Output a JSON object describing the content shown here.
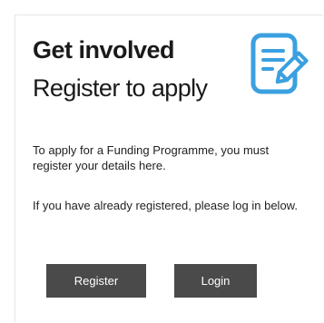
{
  "card": {
    "title": "Get involved",
    "subtitle": "Register to apply",
    "icon": "form-edit-icon",
    "paragraphs": [
      "To apply for a Funding Programme, you must register your details here.",
      "If you have already registered, please log in below."
    ],
    "buttons": {
      "register_label": "Register",
      "login_label": "Login"
    }
  },
  "colors": {
    "icon_blue": "#3aa0e0",
    "button_bg": "#4a4a4a",
    "text": "#1a1a1a"
  }
}
